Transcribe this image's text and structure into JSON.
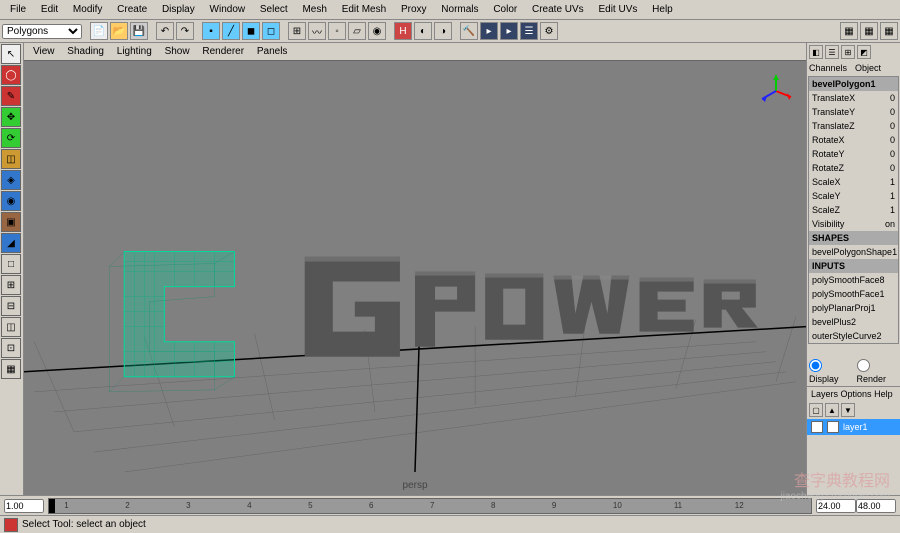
{
  "menubar": [
    "File",
    "Edit",
    "Modify",
    "Create",
    "Display",
    "Window",
    "Select",
    "Mesh",
    "Edit Mesh",
    "Proxy",
    "Normals",
    "Color",
    "Create UVs",
    "Edit UVs",
    "Help"
  ],
  "dropdown": "Polygons",
  "viewport_menu": [
    "View",
    "Shading",
    "Lighting",
    "Show",
    "Renderer",
    "Panels"
  ],
  "channels": {
    "tabs": [
      "Channels",
      "Object"
    ],
    "object_name": "bevelPolygon1",
    "attrs": [
      {
        "k": "TranslateX",
        "v": "0"
      },
      {
        "k": "TranslateY",
        "v": "0"
      },
      {
        "k": "TranslateZ",
        "v": "0"
      },
      {
        "k": "RotateX",
        "v": "0"
      },
      {
        "k": "RotateY",
        "v": "0"
      },
      {
        "k": "RotateZ",
        "v": "0"
      },
      {
        "k": "ScaleX",
        "v": "1"
      },
      {
        "k": "ScaleY",
        "v": "1"
      },
      {
        "k": "ScaleZ",
        "v": "1"
      },
      {
        "k": "Visibility",
        "v": "on"
      }
    ],
    "shapes_header": "SHAPES",
    "shapes": [
      "bevelPolygonShape1"
    ],
    "inputs_header": "INPUTS",
    "inputs": [
      "polySmoothFace8",
      "polySmoothFace1",
      "polyPlanarProj1",
      "bevelPlus2",
      "outerStyleCurve2"
    ]
  },
  "display_tabs": {
    "display": "Display",
    "render": "Render"
  },
  "layers_menu": [
    "Layers",
    "Options",
    "Help"
  ],
  "layer1": "layer1",
  "timeline": {
    "start": "1.00",
    "end1": "24.00",
    "end2": "48.00",
    "end3": "48.00"
  },
  "status": "Select Tool: select an object",
  "persp": "persp",
  "watermark": {
    "main": "查字典教程网",
    "sub": "jiaocheng.chazidian.com"
  },
  "colors": {
    "wireframe": "#00d99e",
    "mesh": "#555555",
    "bg": "#808080",
    "select_blue": "#3399ff"
  }
}
